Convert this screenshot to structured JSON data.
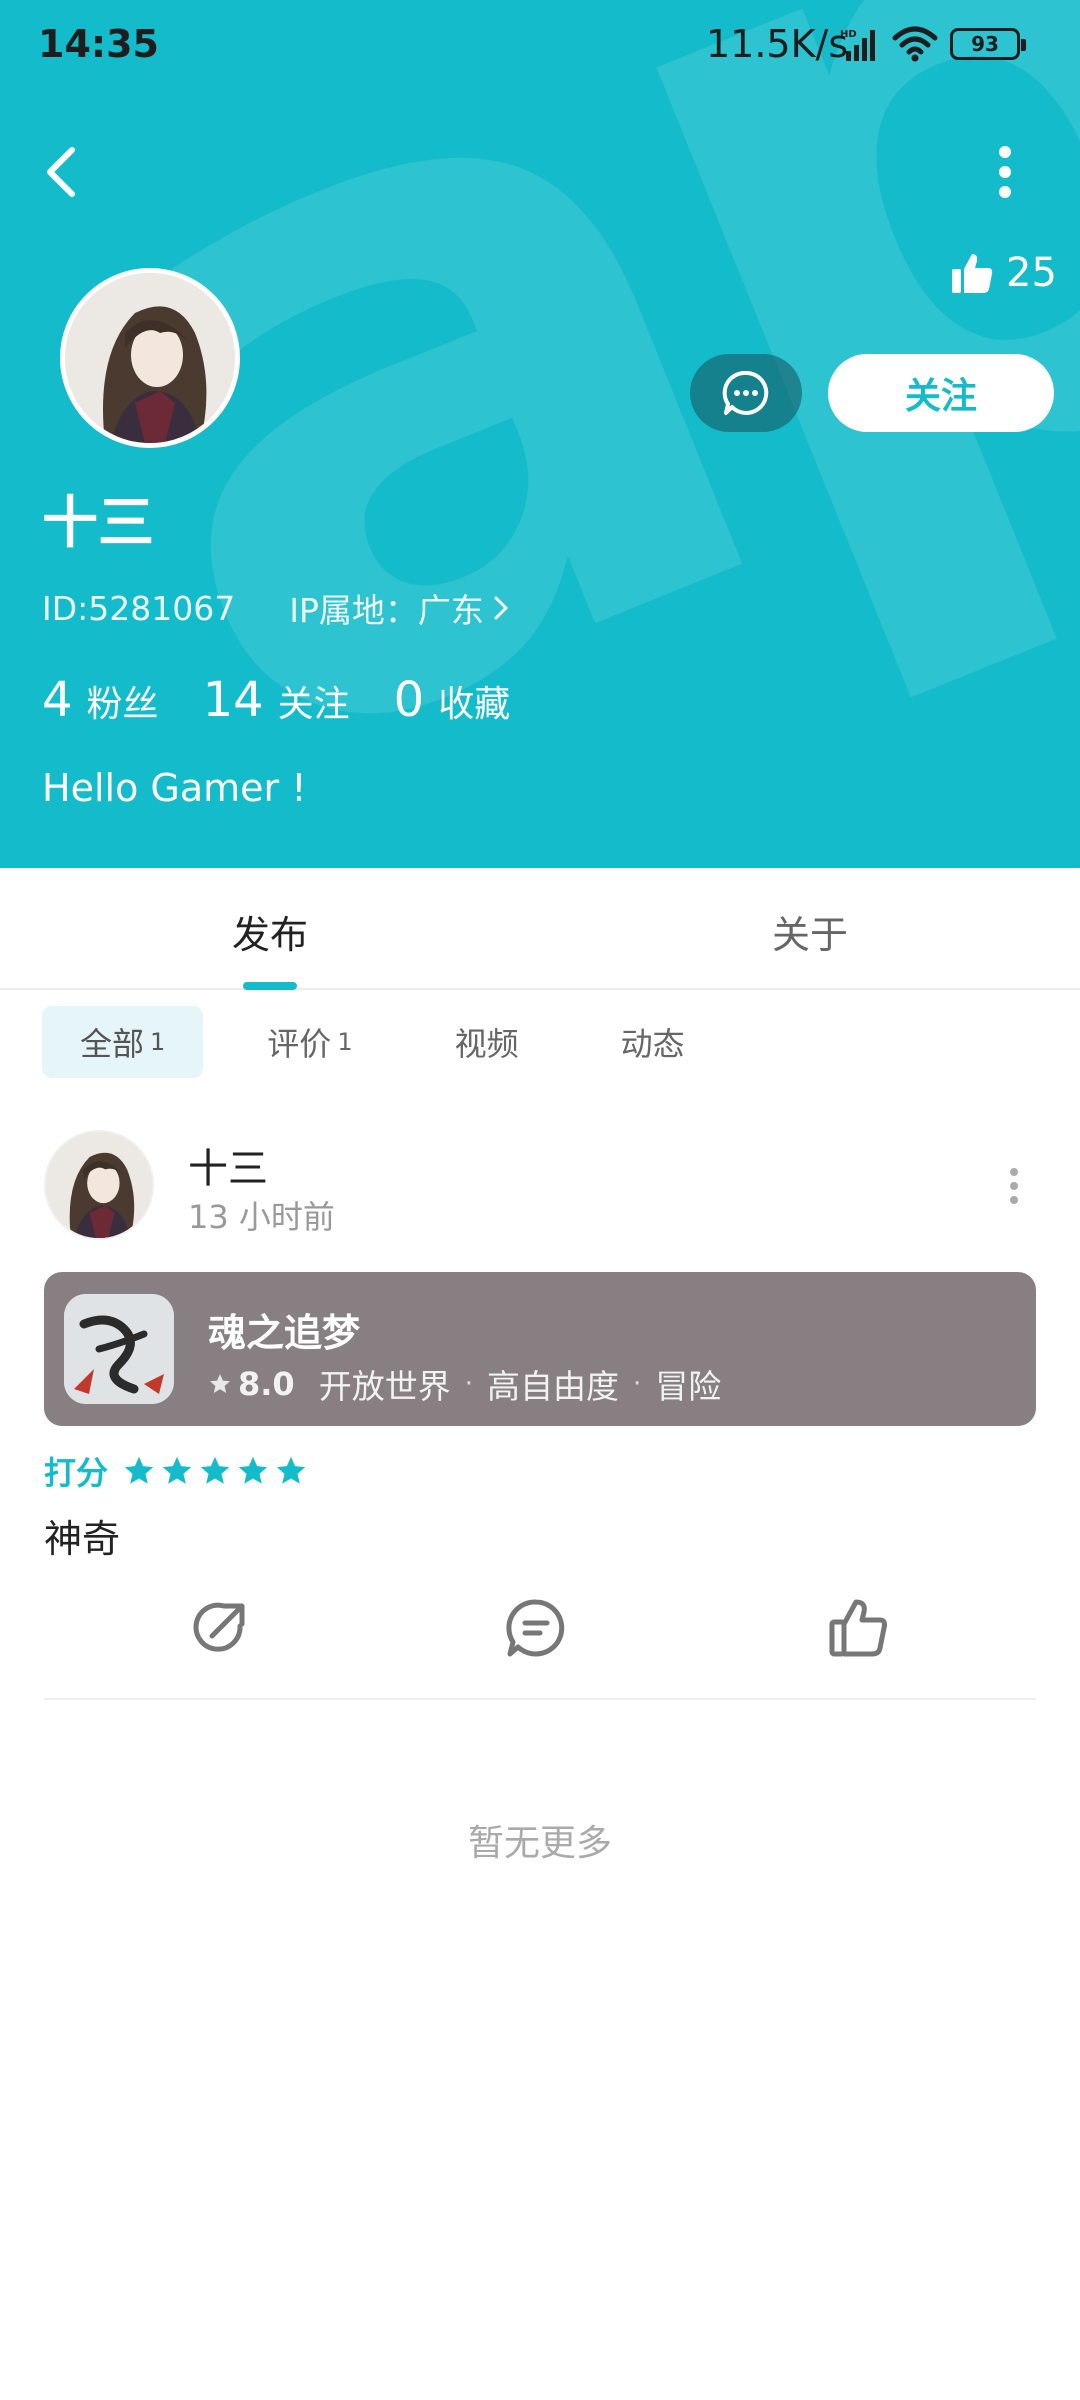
{
  "status_bar": {
    "time": "14:35",
    "net_speed": "11.5K/s",
    "network_badge": "HD",
    "battery": "93"
  },
  "header": {
    "watermark": "apTa",
    "likes_count": "25",
    "follow_label": "关注",
    "username": "十三",
    "user_id": "ID:5281067",
    "ip_location": "IP属地：广东",
    "stats": [
      {
        "num": "4",
        "label": "粉丝"
      },
      {
        "num": "14",
        "label": "关注"
      },
      {
        "num": "0",
        "label": "收藏"
      }
    ],
    "bio": "Hello Gamer !",
    "accent_color": "#14bccb"
  },
  "tabs": [
    {
      "label": "发布",
      "active": true
    },
    {
      "label": "关于",
      "active": false
    }
  ],
  "filters": [
    {
      "label": "全部",
      "count": "1",
      "active": true
    },
    {
      "label": "评价",
      "count": "1",
      "active": false
    },
    {
      "label": "视频",
      "count": "",
      "active": false
    },
    {
      "label": "动态",
      "count": "",
      "active": false
    }
  ],
  "post": {
    "author": "十三",
    "time": "13 小时前",
    "game": {
      "name": "魂之追梦",
      "score": "8.0",
      "tags": [
        "开放世界",
        "高自由度",
        "冒险"
      ]
    },
    "rating_label": "打分",
    "stars": 5,
    "review": "神奇",
    "actions": [
      "share-icon",
      "comment-icon",
      "like-icon"
    ]
  },
  "footer": {
    "no_more": "暂无更多"
  }
}
